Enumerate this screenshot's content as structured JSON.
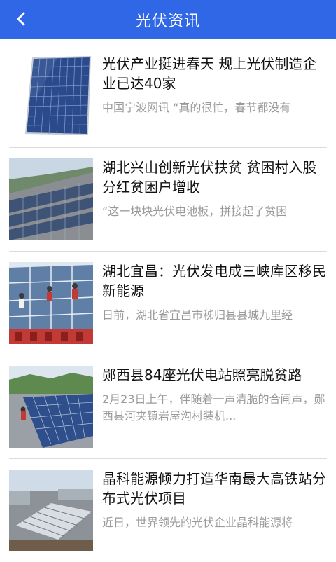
{
  "header": {
    "title": "光伏资讯",
    "back_icon": "chevron-left-icon",
    "bg_color": "#2f67e6"
  },
  "articles": [
    {
      "title": "光伏产业挺进春天 规上光伏制造企业已达40家",
      "summary": "中国宁波网讯 “真的很忙，春节都没有"
    },
    {
      "title": "湖北兴山创新光伏扶贫 贫困村入股分红贫困户增收",
      "summary": "“这一块块光伏电池板，拼接起了贫困"
    },
    {
      "title": "湖北宜昌：光伏发电成三峡库区移民新能源",
      "summary": "日前，湖北省宜昌市秭归县县城九里经"
    },
    {
      "title": "郧西县84座光伏电站照亮脱贫路",
      "summary": "2月23日上午，伴随着一声清脆的合闸声，郧西县河夹镇岩屋沟村装机..."
    },
    {
      "title": "晶科能源倾力打造华南最大高铁站分布式光伏项目",
      "summary": "近日，世界领先的光伏企业晶科能源将"
    }
  ]
}
